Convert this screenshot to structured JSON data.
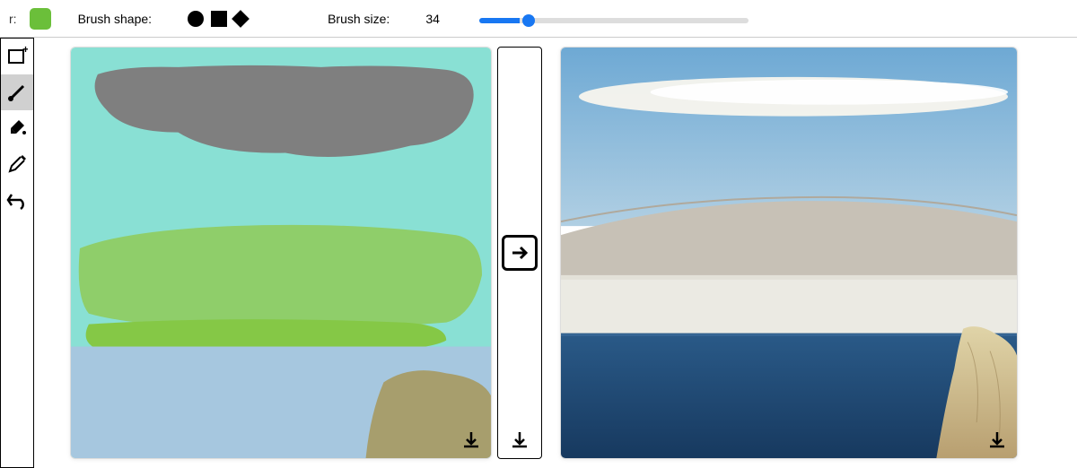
{
  "toolbar": {
    "color_label_fragment": "r:",
    "brush_color": "#6bbf3a",
    "shape_label": "Brush shape:",
    "shapes": [
      "circle",
      "square",
      "diamond"
    ],
    "size_label": "Brush size:",
    "size_value": "34",
    "size_min": 1,
    "size_max": 200
  },
  "sidebar_tools": [
    {
      "name": "add-image-tool",
      "selected": false
    },
    {
      "name": "brush-tool",
      "selected": true
    },
    {
      "name": "fill-tool",
      "selected": false
    },
    {
      "name": "eyedropper-tool",
      "selected": false
    },
    {
      "name": "undo-tool",
      "selected": false
    }
  ],
  "canvas_palette": {
    "sky": "#89e0d4",
    "cloud": "#7f7f7f",
    "grass_light": "#8fce6a",
    "grass_dark": "#85c846",
    "water": "#a6c7df",
    "sand": "#a79e6d"
  },
  "output_palette": {
    "sky_top": "#78b3dc",
    "sky_bottom": "#b8d4e6",
    "cloud": "#f5f5f0",
    "land": "#c6c0b8",
    "haze": "#e6e6e0",
    "sea": "#1e4a76",
    "rock": "#d4c49a"
  },
  "icons": {
    "arrow": "arrow-right-icon",
    "download": "download-icon"
  }
}
